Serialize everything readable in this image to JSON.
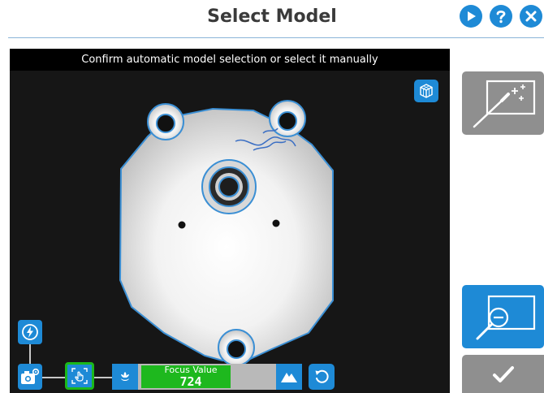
{
  "header": {
    "title": "Select Model",
    "buttons": [
      {
        "name": "play",
        "icon": "play-icon"
      },
      {
        "name": "help",
        "icon": "help-icon"
      },
      {
        "name": "close",
        "icon": "close-icon"
      }
    ]
  },
  "view": {
    "instruction": "Confirm automatic model selection or select it manually",
    "focus": {
      "label": "Focus Value",
      "value": "724",
      "fill_fraction": 0.68
    }
  },
  "colors": {
    "accent": "#1e8ad6",
    "focus_green": "#1eb81e",
    "selected_outline": "#1bb81b",
    "disabled_gray": "#8f8f8f"
  },
  "icons": {
    "cube": "cube-icon",
    "flash": "flash-auto-icon",
    "camera": "camera-settings-icon",
    "hand": "hand-select-icon",
    "flower": "macro-flower-icon",
    "mountain": "landscape-mountain-icon",
    "reset": "reset-icon",
    "wand": "magic-wand-icon",
    "zoom": "zoom-out-icon",
    "check": "check-icon"
  }
}
